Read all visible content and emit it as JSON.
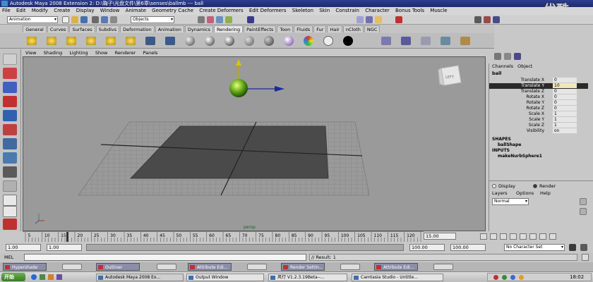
{
  "title": "Autodesk Maya 2008 Extension 2: D:\\鞠子\\光盘文件\\第6章\\senses\\ballmb  ---  ball",
  "menus": [
    "File",
    "Edit",
    "Modify",
    "Create",
    "Display",
    "Window",
    "Animate",
    "Geometry Cache",
    "Create Deformers",
    "Edit Deformers",
    "Skeleton",
    "Skin",
    "Constrain",
    "Character",
    "Bonus Tools",
    "Muscle"
  ],
  "watermark": "优酷",
  "statusline": {
    "mode": "Animation",
    "selection": "Objects"
  },
  "shelf_tabs": [
    "General",
    "Curves",
    "Surfaces",
    "Subdivs",
    "Deformation",
    "Animation",
    "Dynamics",
    "Rendering",
    "PaintEffects",
    "Toon",
    "Fluids",
    "Fur",
    "Hair",
    "nCloth",
    "NGC"
  ],
  "active_shelf": "Rendering",
  "viewport_menu": [
    "View",
    "Shading",
    "Lighting",
    "Show",
    "Renderer",
    "Panels"
  ],
  "viewcube": "LEFT",
  "camera_label": "persp",
  "channel_box": {
    "tabs": [
      "Channels",
      "Object"
    ],
    "object": "ball",
    "channels": [
      {
        "name": "Translate X",
        "value": "0"
      },
      {
        "name": "Translate Y",
        "value": "10"
      },
      {
        "name": "Translate Z",
        "value": "0"
      },
      {
        "name": "Rotate X",
        "value": "0"
      },
      {
        "name": "Rotate Y",
        "value": "0"
      },
      {
        "name": "Rotate Z",
        "value": "0"
      },
      {
        "name": "Scale X",
        "value": "1"
      },
      {
        "name": "Scale Y",
        "value": "1"
      },
      {
        "name": "Scale Z",
        "value": "1"
      },
      {
        "name": "Visibility",
        "value": "on"
      }
    ],
    "selected_channel": "Translate Y",
    "shapes_header": "SHAPES",
    "shape": "ballShape",
    "inputs_header": "INPUTS",
    "input": "makeNurbSphere1"
  },
  "layer_editor": {
    "display_label": "Display",
    "render_label": "Render",
    "menus": [
      "Layers",
      "Options",
      "Help"
    ],
    "mode": "Normal"
  },
  "timeline": {
    "ticks": [
      "5",
      "10",
      "15",
      "20",
      "25",
      "30",
      "35",
      "40",
      "45",
      "50",
      "55",
      "60",
      "65",
      "70",
      "75",
      "80",
      "85",
      "90",
      "95",
      "100",
      "105",
      "110",
      "115",
      "120"
    ],
    "current_frame": "15.00"
  },
  "range": {
    "start_time": "1.00",
    "start_range": "1.00",
    "end_range": "100.00",
    "end_time": "100.00",
    "character": "No Character Set"
  },
  "command": {
    "label": "MEL",
    "result": "// Result: 1"
  },
  "minimized_windows": [
    "Hypershade",
    "Outliner",
    "Attribute Edi...",
    "Render Settin...",
    "Attribute Edi..."
  ],
  "taskbar": {
    "start": "开始",
    "tasks": [
      "Autodesk Maya 2008 Ex...",
      "Output Window",
      "风行 V1.2.3.19Beta--...",
      "Camtasia Studio - Untitle..."
    ],
    "clock": "18:02"
  }
}
